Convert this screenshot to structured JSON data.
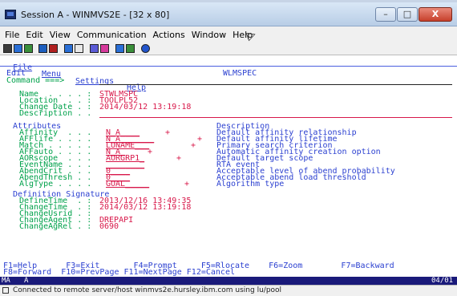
{
  "window": {
    "title": "Session A - WINMVS2E - [32 x 80]"
  },
  "menu": [
    "File",
    "Edit",
    "View",
    "Communication",
    "Actions",
    "Window",
    "Help"
  ],
  "toolbar_icons": [
    "print-icon",
    "copy-icon",
    "paste-icon",
    "send-icon",
    "receive-icon",
    "display-icon",
    "macro-play-icon",
    "macro-record-icon",
    "map-icon",
    "colors-icon",
    "settings-icon",
    "help-icon"
  ],
  "terminal": {
    "menu": [
      "File",
      "Menu",
      "Settings",
      "Help"
    ],
    "mode": "Edit",
    "panel": "WLMSPEC",
    "command_label": "Command ===>",
    "header_fields": [
      {
        "label": "Name  . . . . :",
        "value": "STWLMSPC"
      },
      {
        "label": "Location  . . :",
        "value": "TOOLPL52"
      },
      {
        "label": "Change Date . :",
        "value": "2014/03/12 13:19:18"
      },
      {
        "label": "Description . .",
        "value": ""
      }
    ],
    "attributes_header": "Attributes",
    "description_header": "Description",
    "attributes": [
      {
        "label": "Affinity  . . .",
        "value": "N_A____",
        "plus": "+",
        "desc": "Default affinity relationship"
      },
      {
        "label": "AFFlife . . . .",
        "value": "N_A_______",
        "plus": "+",
        "desc": "Default affinity lifetime"
      },
      {
        "label": "Match . . . . .",
        "value": "LUNAME___",
        "plus": "+",
        "desc": "Primary search criterion"
      },
      {
        "label": "AFFauto . . . .",
        "value": "N_A_",
        "plus": "+",
        "desc": "Automatic affinity creation option"
      },
      {
        "label": "AORscope  . . .",
        "value": "AORGRP1_",
        "plus": "+",
        "desc": "Default target scope"
      },
      {
        "label": "EventName . . .",
        "value": "________",
        "plus": "",
        "desc": "RTA event"
      },
      {
        "label": "AbendCrit . . .",
        "value": "0____",
        "plus": "",
        "desc": "Acceptable level of abend probability"
      },
      {
        "label": "AbendThresh . .",
        "value": "0____",
        "plus": "",
        "desc": "Acceptable abend load threshold"
      },
      {
        "label": "AlgType . . . .",
        "value": "GOAL_____",
        "plus": "+",
        "desc": "Algorithm type"
      }
    ],
    "signature_header": "Definition Signature",
    "signature": [
      {
        "label": "DefineTime  . :",
        "value": "2013/12/16 13:49:35"
      },
      {
        "label": "ChangeTime  . :",
        "value": "2014/03/12 13:19:18"
      },
      {
        "label": "ChangeUsrid . :",
        "value": ""
      },
      {
        "label": "ChangeAgent . :",
        "value": "DREPAPI"
      },
      {
        "label": "ChangeAgRel . :",
        "value": "0690"
      }
    ],
    "pf_keys_1": "F1=Help      F3=Exit       F4=Prompt     F5=Rlocate    F6=Zoom        F7=Backward",
    "pf_keys_2": "F8=Forward  F10=PrevPage F11=NextPage F12=Cancel",
    "oia_left": "MA",
    "oia_mode": "A",
    "oia_right": "04/01"
  },
  "statusbar": {
    "text": "Connected to remote server/host winmvs2e.hursley.ibm.com using lu/pool"
  },
  "colors": {
    "title_bg": "#c9dcf0",
    "terminal_bg": "#ffffff",
    "text_blue": "#2a3fd0",
    "text_red": "#d8184a",
    "text_green": "#00a14b"
  }
}
